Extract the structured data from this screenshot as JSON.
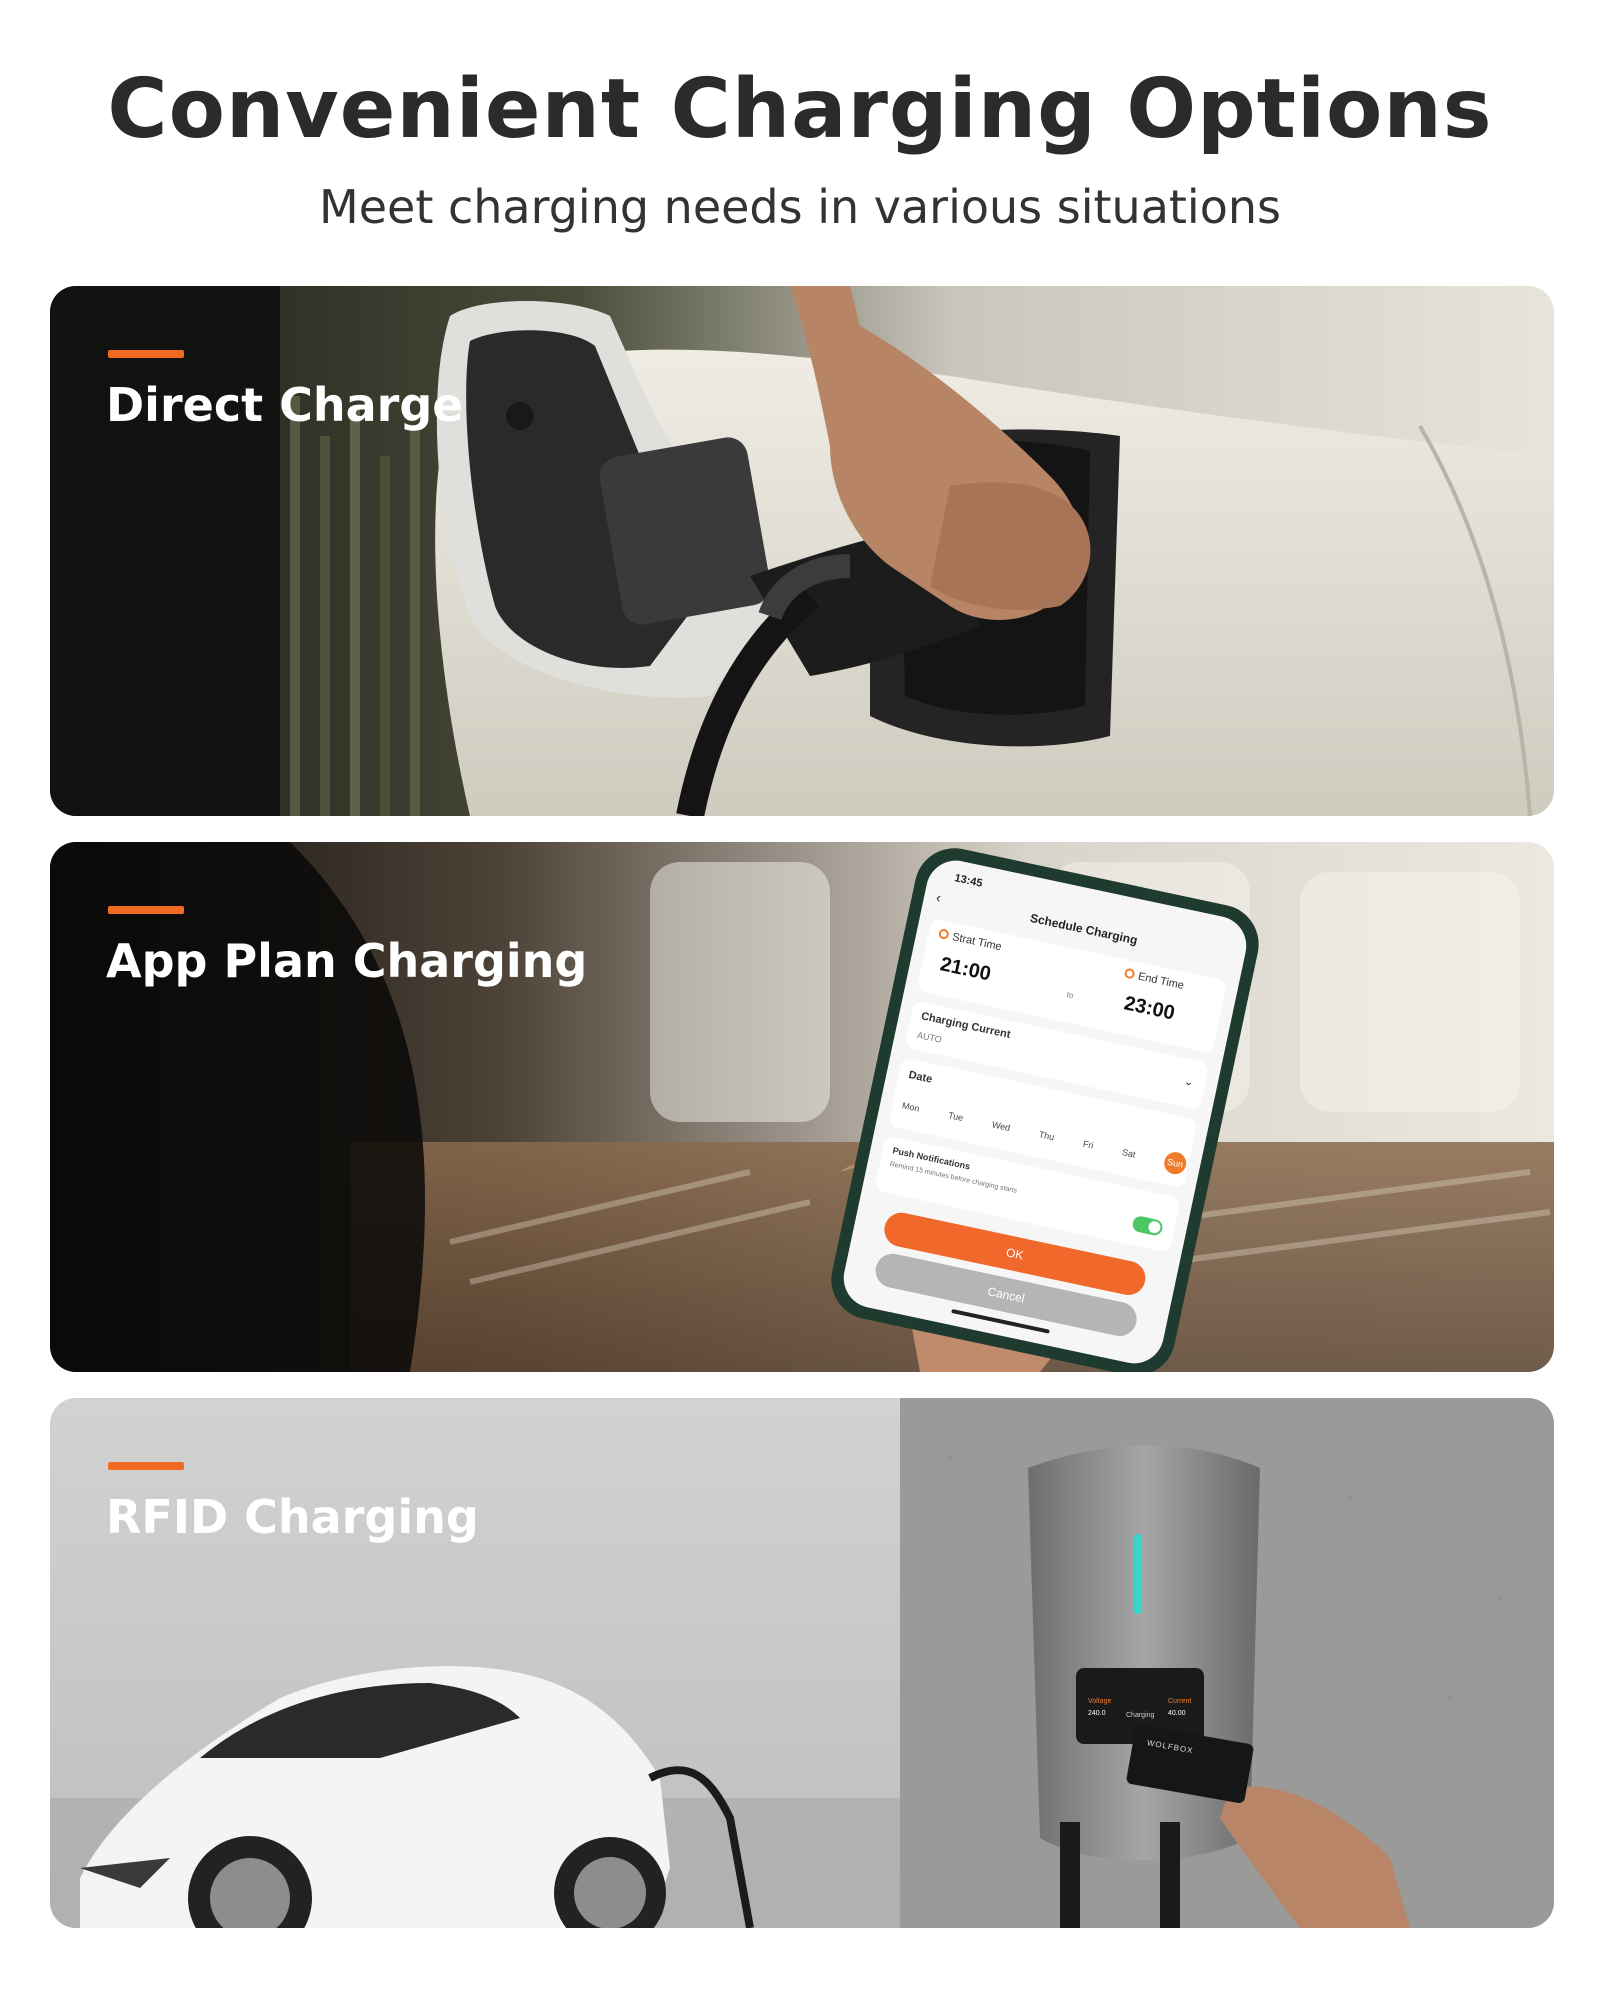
{
  "header": {
    "title": "Convenient Charging Options",
    "subtitle": "Meet charging needs in various situations"
  },
  "accent_color": "#f06a24",
  "sections": [
    {
      "title": "Direct Charge"
    },
    {
      "title": "App Plan Charging"
    },
    {
      "title": "RFID Charging"
    }
  ],
  "app_screen": {
    "clock": "13:45",
    "title": "Schedule Charging",
    "start_label": "Strat Time",
    "start_value": "21:00",
    "to_label": "to",
    "end_label": "End Time",
    "end_value": "23:00",
    "current_label": "Charging Current",
    "current_value": "AUTO",
    "date_label": "Date",
    "days": [
      "Mon",
      "Tue",
      "Wed",
      "Thu",
      "Fri",
      "Sat",
      "Sun"
    ],
    "selected_day": "Sun",
    "push_label": "Push Notifications",
    "push_note": "Remind 15 minutes before charging starts",
    "push_enabled": true,
    "ok_label": "OK",
    "cancel_label": "Cancel"
  },
  "charger_screen": {
    "voltage_label": "Voltage",
    "voltage_value": "240.0",
    "status_label": "Charging",
    "current_label": "Current",
    "current_value": "40.00"
  },
  "rfid_card": {
    "brand": "WOLFBOX"
  }
}
